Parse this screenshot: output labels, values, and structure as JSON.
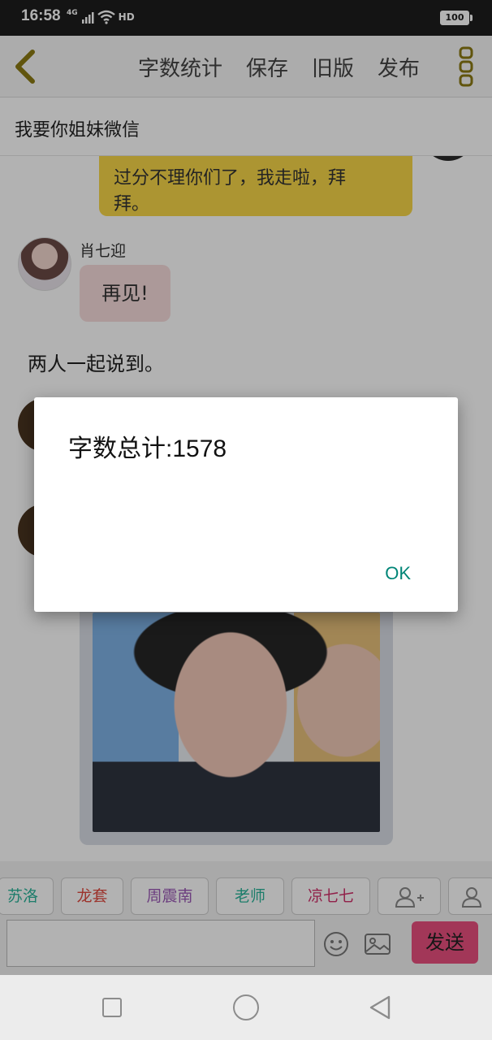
{
  "status_bar": {
    "time": "16:58",
    "network": "4G",
    "hd_label": "HD",
    "battery": "100"
  },
  "toolbar": {
    "items": [
      "字数统计",
      "保存",
      "旧版",
      "发布"
    ],
    "back_icon": "chevron-left-icon",
    "more_icon": "more-vertical-icon",
    "accent_color": "#8c7a14"
  },
  "story": {
    "title": "我要你姐妹微信"
  },
  "chat": {
    "messages": [
      {
        "type": "bubble_right",
        "text_lines": [
          "过分不理你们了，我走啦，拜",
          "拜。"
        ],
        "color": "#f7d648"
      },
      {
        "type": "bubble_left",
        "speaker": "肖七迎",
        "text": "再见!",
        "color": "#f7dcdc"
      },
      {
        "type": "narration",
        "text": "两人一起说到。"
      },
      {
        "type": "image_left"
      }
    ]
  },
  "characters": {
    "chips": [
      {
        "label": "苏洛洛",
        "color": "#2bb39a"
      },
      {
        "label": "龙套",
        "color": "#e04a3f"
      },
      {
        "label": "周震南",
        "color": "#9b59b6"
      },
      {
        "label": "老师",
        "color": "#2bb39a"
      },
      {
        "label": "凉七七",
        "color": "#d0306a"
      }
    ],
    "add_character_icon": "user-add-icon",
    "character_icon": "user-icon"
  },
  "composer": {
    "input_value": "",
    "emoji_icon": "emoji-icon",
    "image_icon": "image-icon",
    "send_label": "发送",
    "send_color": "#e84f7e"
  },
  "dialog": {
    "message": "字数总计:1578",
    "ok_label": "OK",
    "ok_color": "#008577"
  },
  "nav": {
    "recent_icon": "square-icon",
    "home_icon": "circle-icon",
    "back_icon": "triangle-back-icon"
  }
}
